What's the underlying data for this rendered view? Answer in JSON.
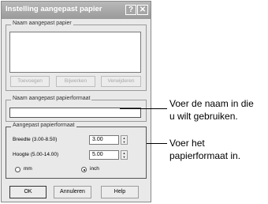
{
  "window": {
    "title": "Instelling aangepast papier",
    "help_glyph": "?",
    "close_glyph": "✕"
  },
  "paper_list_group": {
    "label": "Naam aangepast papier",
    "buttons": [
      "Toevoegen",
      "Bijwerken",
      "Verwijderen"
    ]
  },
  "name_group": {
    "label": "Naam aangepast papierformaat",
    "value": ""
  },
  "size_group": {
    "label": "Aangepast papierformaat",
    "width_label": "Breedte (3.00-8.50)",
    "width_value": "3.00",
    "height_label": "Hoogte (5.00-14.00)",
    "height_value": "5.00",
    "unit_mm": "mm",
    "unit_inch": "inch",
    "selected_unit": "inch"
  },
  "footer": {
    "ok": "OK",
    "cancel": "Annuleren",
    "help": "Help"
  },
  "callouts": {
    "name_line1": "Voer de naam in die",
    "name_line2": "u wilt gebruiken.",
    "size_line1": "Voer het",
    "size_line2": "papierformaat in."
  }
}
